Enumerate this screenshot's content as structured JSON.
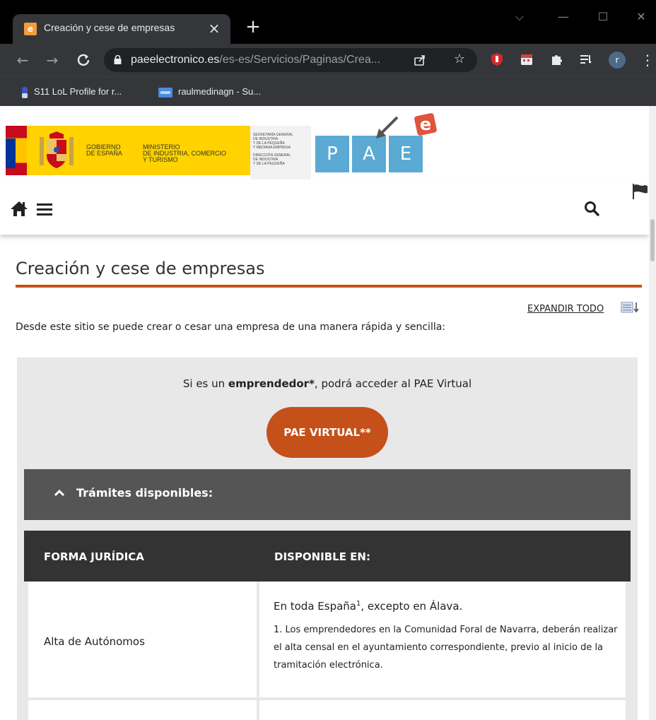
{
  "browser": {
    "tab_title": "Creación y cese de empresas",
    "tab_favicon_letter": "e",
    "url_host": "paeelectronico.es",
    "url_path": "/es-es/Servicios/Paginas/Crea...",
    "profile_initial": "r",
    "bookmarks": [
      {
        "label": "S11 LoL Profile for r..."
      },
      {
        "label": "raulmedinagn - Su..."
      }
    ]
  },
  "banner": {
    "gobierno": [
      "GOBIERNO",
      "DE ESPAÑA"
    ],
    "ministerio": [
      "MINISTERIO",
      "DE INDUSTRIA, COMERCIO",
      "Y TURISMO"
    ],
    "secretaria": [
      "SECRETARÍA GENERAL",
      "DE INDUSTRIA",
      "Y DE LA PEQUEÑA",
      "Y MEDIANA EMPRESA",
      "DIRECCIÓN GENERAL",
      "DE INDUSTRIA",
      "Y DE LA PEQUEÑA"
    ],
    "pae_letters": [
      "P",
      "A",
      "E"
    ],
    "pae_badge_letter": "e"
  },
  "page": {
    "title": "Creación y cese de empresas",
    "expand_all": "EXPANDIR TODO",
    "intro": "Desde este sitio se puede crear o cesar una empresa de una manera rápida y sencilla:",
    "emprendedor_prefix": "Si es un ",
    "emprendedor_bold": "emprendedor*",
    "emprendedor_suffix": ", podrá acceder al PAE Virtual",
    "pae_virtual_button": "PAE VIRTUAL**",
    "tramites_label": "Trámites disponibles:",
    "table": {
      "headers": [
        "FORMA JURÍDICA",
        "DISPONIBLE EN:"
      ],
      "rows": [
        {
          "forma": "Alta de Autónomos",
          "disponible_main": "En toda España",
          "disponible_sup": "1",
          "disponible_rest": ", excepto en Álava.",
          "note": "1. Los emprendedores en la Comunidad Foral de Navarra, deberán realizar el alta censal en el ayuntamiento correspondiente, previo al inicio de la tramitación electrónica."
        }
      ]
    }
  },
  "colors": {
    "accent": "#c5501a",
    "pae_blue": "#5aaad4",
    "header_dark": "#333333",
    "tramites_gray": "#555555"
  }
}
